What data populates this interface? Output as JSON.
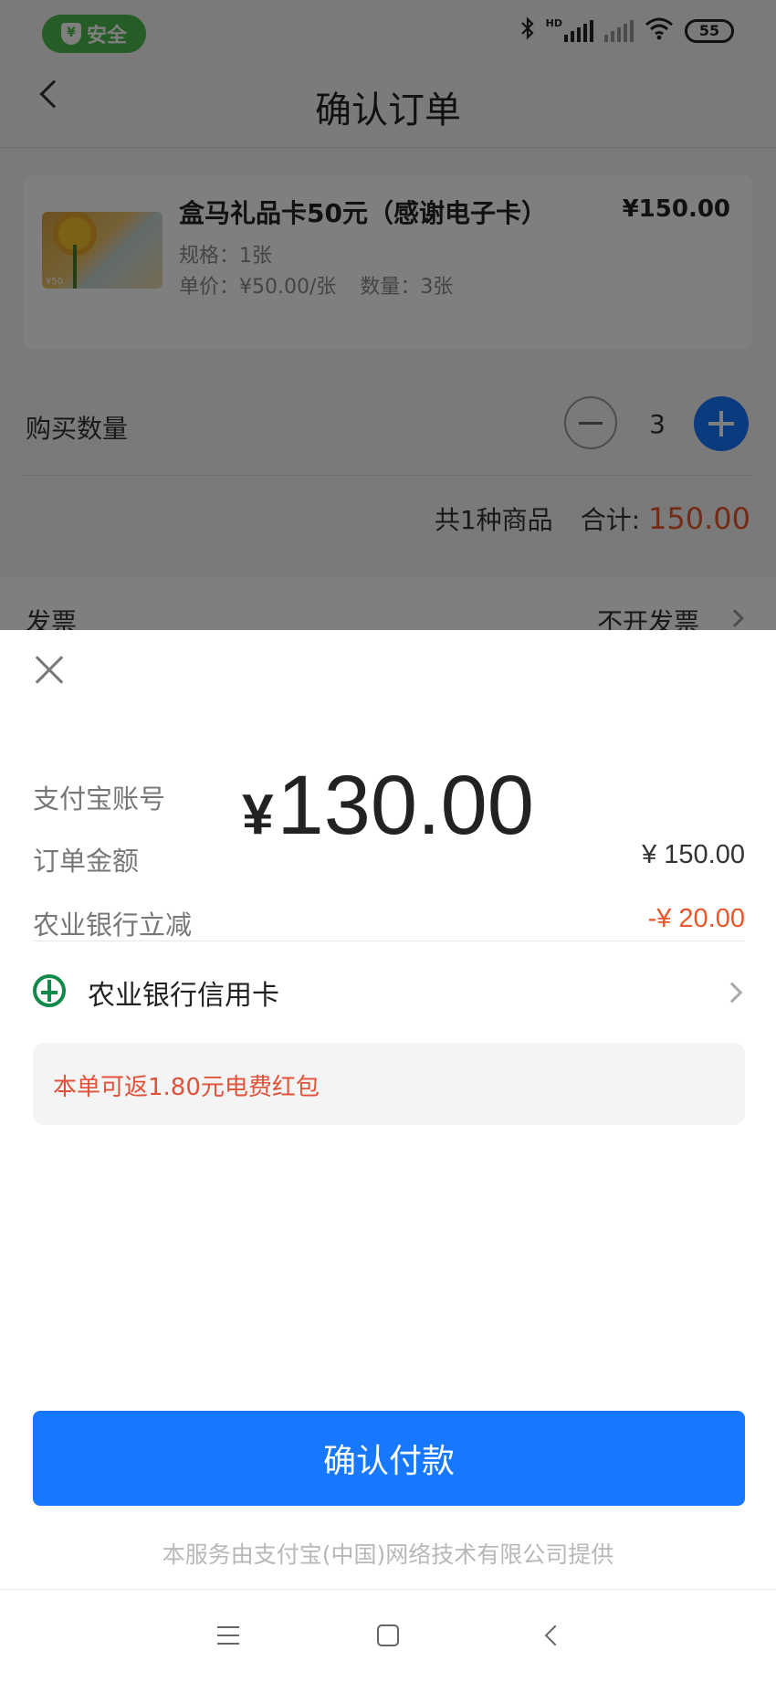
{
  "status_bar": {
    "safe_label": "安全",
    "safe_icon_glyph": "¥",
    "hd_label": "HD",
    "battery": "55"
  },
  "header": {
    "title": "确认订单"
  },
  "order": {
    "product_name": "盒马礼品卡50元（感谢电子卡）",
    "product_price": "¥150.00",
    "spec": "规格：1张",
    "unit_price": "单价：¥50.00/张",
    "quantity_text": "数量：3张",
    "thumb_label": "¥50",
    "qty_label": "购买数量",
    "qty_value": "3",
    "summary_count": "共1种商品",
    "summary_total_label": "合计:",
    "summary_total_value": "150.00",
    "invoice_label": "发票",
    "invoice_value": "不开发票"
  },
  "payment": {
    "amount_symbol": "¥",
    "amount": "130.00",
    "account_label": "支付宝账号",
    "order_amount_label": "订单金额",
    "order_amount_value": "¥ 150.00",
    "discount_label": "农业银行立减",
    "discount_value": "-¥ 20.00",
    "method_label": "农业银行信用卡",
    "promo_text": "本单可返1.80元电费红包",
    "confirm_label": "确认付款",
    "service_note": "本服务由支付宝(中国)网络技术有限公司提供"
  },
  "colors": {
    "accent_blue": "#1677ff",
    "price_red": "#e8562a",
    "safe_green": "#4cb84a",
    "bank_green": "#0f8a4a"
  },
  "icons": [
    "shield-icon",
    "bluetooth-icon",
    "signal-icon",
    "wifi-icon",
    "battery-icon",
    "back-icon",
    "minus-icon",
    "plus-icon",
    "chevron-right-icon",
    "close-icon",
    "abc-bank-icon",
    "menu-icon",
    "home-icon",
    "nav-back-icon"
  ]
}
